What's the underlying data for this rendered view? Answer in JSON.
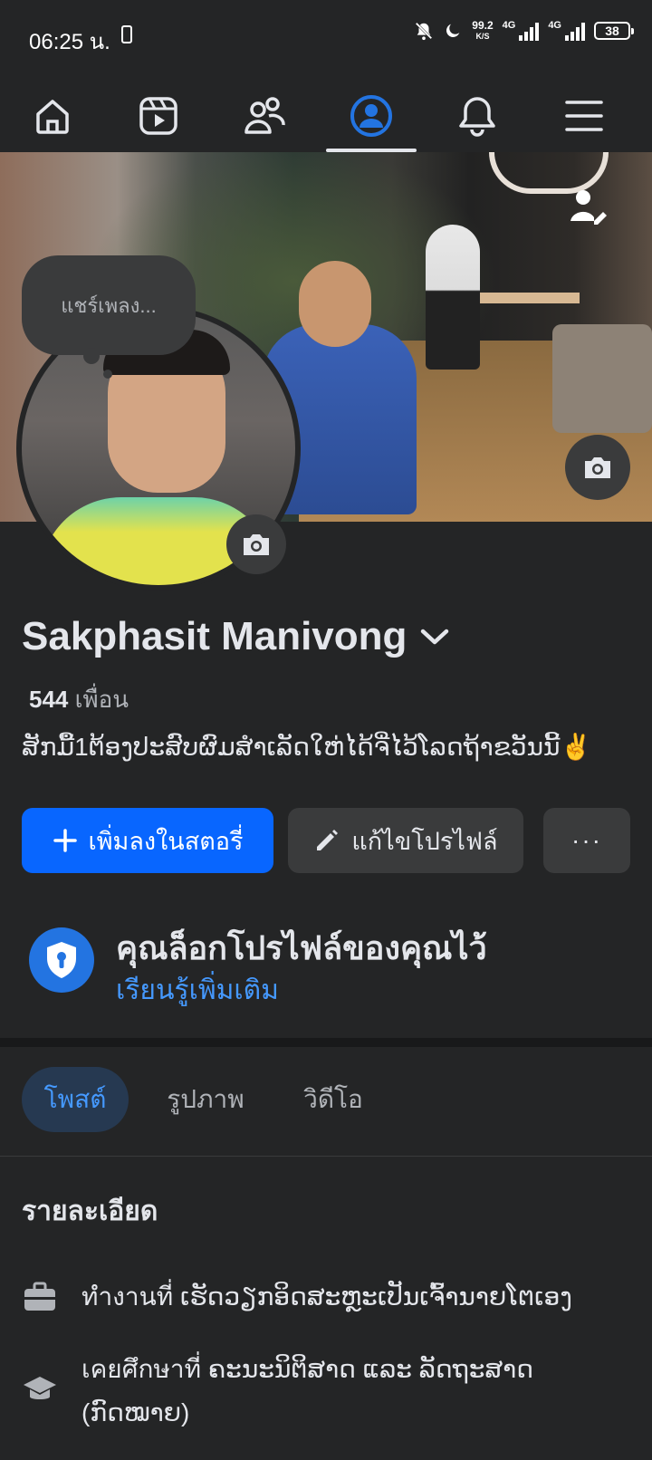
{
  "status_bar": {
    "time": "06:25 น.",
    "net_speed_value": "99.2",
    "net_speed_unit": "K/S",
    "network1": "4G",
    "network2": "4G",
    "battery": "38"
  },
  "nav": {
    "items": [
      "home-icon",
      "reels-icon",
      "friends-icon",
      "profile-icon",
      "bell-icon",
      "menu-icon"
    ],
    "active_index": 3,
    "accent": "#2374e1"
  },
  "profile": {
    "note_placeholder": "แชร์เพลง...",
    "name": "Sakphasit Manivong",
    "friends_count": "544",
    "friends_label": "เพื่อน",
    "bio": "ສັກມື້1ຕ້ອງປະສົບຜົມສຳເລັດໃຫ່ໄດ້ຈີ່ໄວ້ໂລດຖ້າຂວັນນີ້✌️"
  },
  "actions": {
    "add_story": "เพิ่มลงในสตอรี่",
    "edit_profile": "แก้ไขโปรไฟล์",
    "more": "···"
  },
  "lock": {
    "title": "คุณล็อกโปรไฟล์ของคุณไว้",
    "link": "เรียนรู้เพิ่มเติม"
  },
  "tabs": [
    {
      "label": "โพสต์",
      "active": true
    },
    {
      "label": "รูปภาพ",
      "active": false
    },
    {
      "label": "วิดีโอ",
      "active": false
    }
  ],
  "details": {
    "title": "รายละเอียด",
    "work": "ทำงานที่ ເຮັດວຽກອິດສະຫຼະເປັນເຈົ້ານາຍໂຕເອງ",
    "education": "เคยศึกษาที่ ຄະນະນິຕິສາດ ແລະ ລັດຖະສາດ (ກົດໝາຍ)"
  }
}
